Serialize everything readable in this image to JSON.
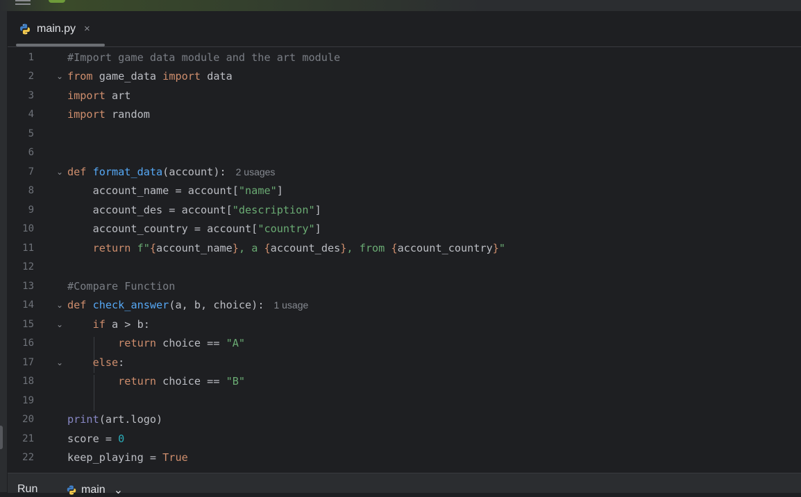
{
  "tab": {
    "filename": "main.py",
    "close_glyph": "×",
    "icon": "python-file-icon"
  },
  "editor": {
    "hints": {
      "format_data": "2 usages",
      "check_answer": "1 usage"
    }
  },
  "bottom": {
    "run_label": "Run",
    "config_name": "main",
    "config_icon": "python-file-icon"
  },
  "colors": {
    "background": "#1e1f22",
    "keyword": "#cf8e6d",
    "function": "#56a8f5",
    "string": "#6aab73",
    "comment": "#7a7e85",
    "number": "#2aacb8",
    "builtin": "#8888c6"
  },
  "lines": [
    {
      "n": "1",
      "fold": "",
      "segs": [
        [
          "cm",
          "#Import game data module and the art module"
        ]
      ]
    },
    {
      "n": "2",
      "fold": "v",
      "segs": [
        [
          "kw",
          "from"
        ],
        [
          "",
          " game_data "
        ],
        [
          "kw",
          "import"
        ],
        [
          "",
          " data"
        ]
      ]
    },
    {
      "n": "3",
      "fold": "",
      "segs": [
        [
          "kw",
          "import"
        ],
        [
          "",
          " art"
        ]
      ]
    },
    {
      "n": "4",
      "fold": "",
      "segs": [
        [
          "kw",
          "import"
        ],
        [
          "",
          " random"
        ]
      ]
    },
    {
      "n": "5",
      "fold": "",
      "segs": []
    },
    {
      "n": "6",
      "fold": "",
      "segs": []
    },
    {
      "n": "7",
      "fold": "v",
      "segs": [
        [
          "kw",
          "def "
        ],
        [
          "fn",
          "format_data"
        ],
        [
          "",
          "(account):"
        ],
        [
          "hint",
          "2 usages"
        ]
      ]
    },
    {
      "n": "8",
      "fold": "",
      "segs": [
        [
          "",
          "    account_name = account["
        ],
        [
          "str",
          "\"name\""
        ],
        [
          "",
          "]"
        ]
      ]
    },
    {
      "n": "9",
      "fold": "",
      "segs": [
        [
          "",
          "    account_des = account["
        ],
        [
          "str",
          "\"description\""
        ],
        [
          "",
          "]"
        ]
      ]
    },
    {
      "n": "10",
      "fold": "",
      "segs": [
        [
          "",
          "    account_country = account["
        ],
        [
          "str",
          "\"country\""
        ],
        [
          "",
          "]"
        ]
      ]
    },
    {
      "n": "11",
      "fold": "",
      "segs": [
        [
          "",
          "    "
        ],
        [
          "kw",
          "return "
        ],
        [
          "str",
          "f\""
        ],
        [
          "kw",
          "{"
        ],
        [
          "",
          "account_name"
        ],
        [
          "kw",
          "}"
        ],
        [
          "str",
          ", a "
        ],
        [
          "kw",
          "{"
        ],
        [
          "",
          "account_des"
        ],
        [
          "kw",
          "}"
        ],
        [
          "str",
          ", from "
        ],
        [
          "kw",
          "{"
        ],
        [
          "",
          "account_country"
        ],
        [
          "kw",
          "}"
        ],
        [
          "str",
          "\""
        ]
      ]
    },
    {
      "n": "12",
      "fold": "",
      "segs": []
    },
    {
      "n": "13",
      "fold": "",
      "segs": [
        [
          "cm",
          "#Compare Function"
        ]
      ]
    },
    {
      "n": "14",
      "fold": "v",
      "segs": [
        [
          "kw",
          "def "
        ],
        [
          "fn",
          "check_answer"
        ],
        [
          "",
          "(a, b, choice):"
        ],
        [
          "hint",
          "1 usage"
        ]
      ]
    },
    {
      "n": "15",
      "fold": "v",
      "segs": [
        [
          "",
          "    "
        ],
        [
          "kw",
          "if"
        ],
        [
          "",
          " a > b:"
        ]
      ]
    },
    {
      "n": "16",
      "fold": "",
      "segs": [
        [
          "",
          "        "
        ],
        [
          "kw",
          "return"
        ],
        [
          "",
          " choice == "
        ],
        [
          "str",
          "\"A\""
        ]
      ]
    },
    {
      "n": "17",
      "fold": "v",
      "segs": [
        [
          "",
          "    "
        ],
        [
          "kw",
          "else"
        ],
        [
          "",
          ":"
        ]
      ]
    },
    {
      "n": "18",
      "fold": "",
      "segs": [
        [
          "",
          "        "
        ],
        [
          "kw",
          "return"
        ],
        [
          "",
          " choice == "
        ],
        [
          "str",
          "\"B\""
        ]
      ]
    },
    {
      "n": "19",
      "fold": "",
      "segs": []
    },
    {
      "n": "20",
      "fold": "",
      "segs": [
        [
          "bi",
          "print"
        ],
        [
          "",
          "(art.logo)"
        ]
      ]
    },
    {
      "n": "21",
      "fold": "",
      "segs": [
        [
          "",
          "score = "
        ],
        [
          "num",
          "0"
        ]
      ]
    },
    {
      "n": "22",
      "fold": "",
      "segs": [
        [
          "",
          "keep_playing = "
        ],
        [
          "kw",
          "True"
        ]
      ]
    }
  ]
}
